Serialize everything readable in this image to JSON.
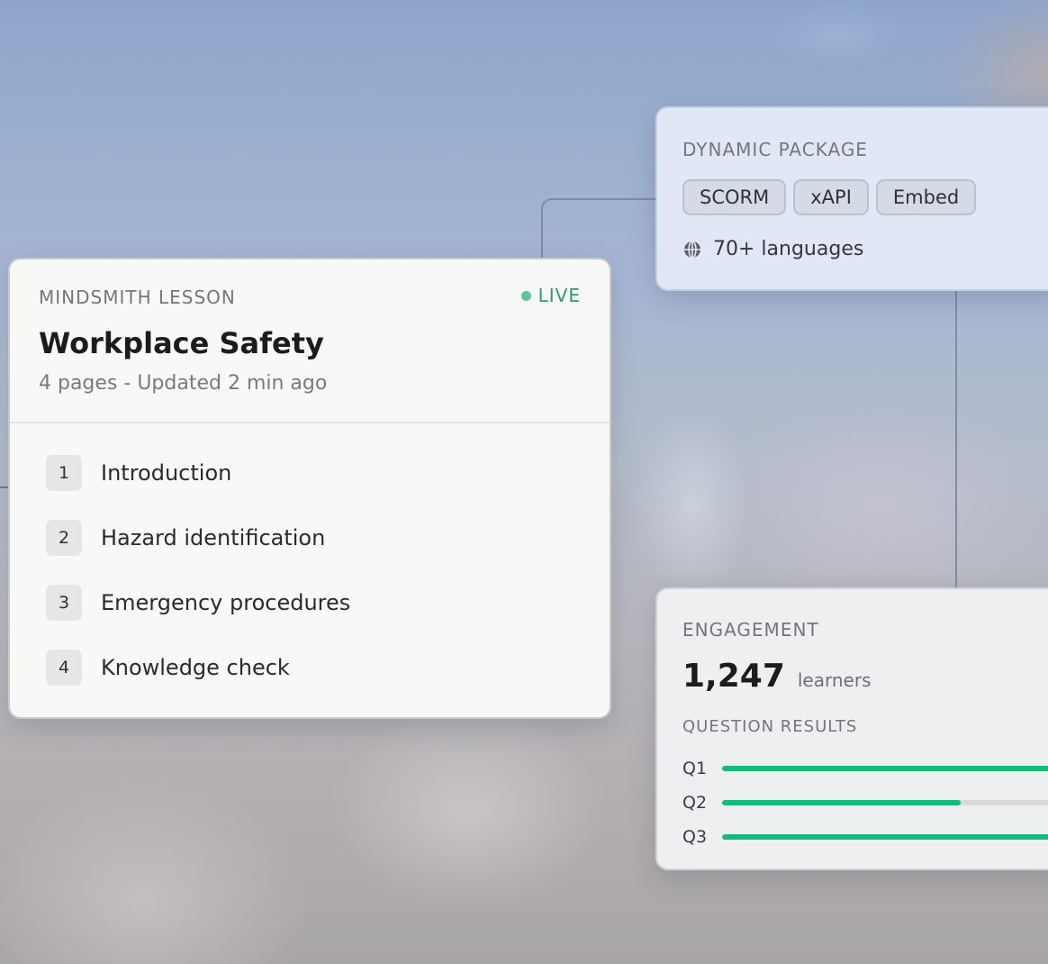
{
  "lesson_card": {
    "eyebrow": "MINDSMITH LESSON",
    "status": "LIVE",
    "title": "Workplace Safety",
    "meta": "4 pages - Updated 2 min ago",
    "pages": [
      {
        "number": "1",
        "label": "Introduction"
      },
      {
        "number": "2",
        "label": "Hazard identification"
      },
      {
        "number": "3",
        "label": "Emergency procedures"
      },
      {
        "number": "4",
        "label": "Knowledge check"
      }
    ],
    "status_color": "#2e9a6f"
  },
  "package_card": {
    "eyebrow": "DYNAMIC PACKAGE",
    "chips": [
      "SCORM",
      "xAPI",
      "Embed"
    ],
    "languages": "70+ languages",
    "language_icon": "globe-icon"
  },
  "engagement_card": {
    "eyebrow": "ENGAGEMENT",
    "learners_count": "1,247",
    "learners_unit": "learners",
    "results_label": "QUESTION RESULTS",
    "questions": [
      {
        "label": "Q1",
        "progress": 1.0
      },
      {
        "label": "Q2",
        "progress": 0.69
      },
      {
        "label": "Q3",
        "progress": 1.0
      }
    ],
    "bar_color": "#15b97a"
  }
}
